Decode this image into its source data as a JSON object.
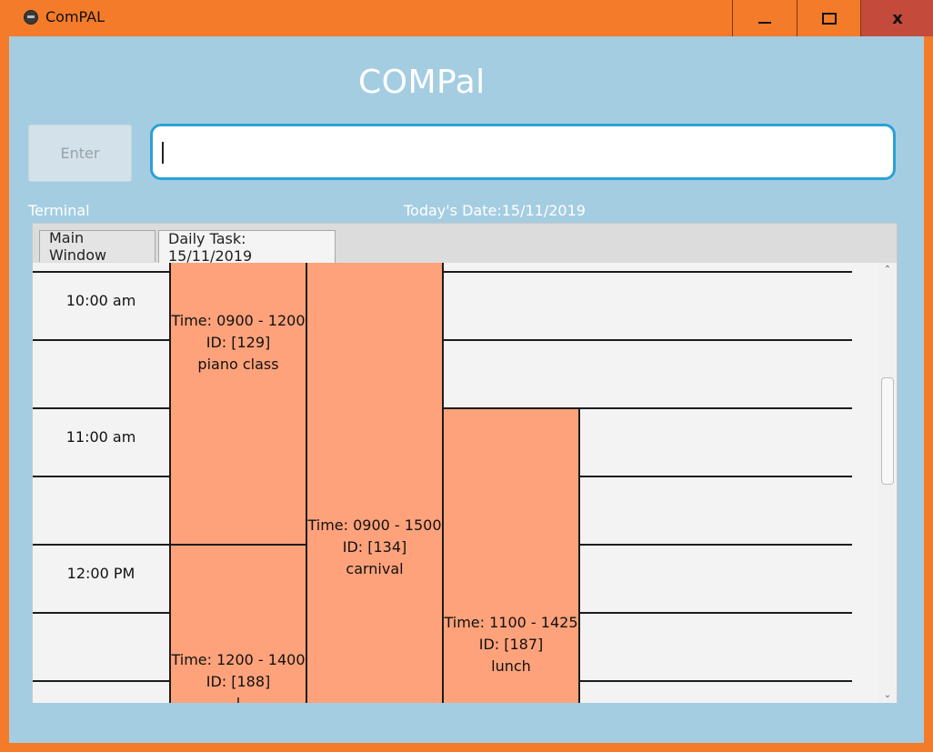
{
  "window": {
    "title": "ComPAL",
    "minimize_icon": "minimize-icon",
    "maximize_icon": "maximize-icon",
    "close_glyph": "x"
  },
  "app": {
    "heading": "COMPal",
    "enter_label": "Enter",
    "command_input_value": "",
    "terminal_label": "Terminal",
    "date_label": "Today's Date:15/11/2019"
  },
  "tabs": [
    {
      "label": "Main Window"
    },
    {
      "label": "Daily Task: 15/11/2019"
    }
  ],
  "schedule": {
    "time_labels": [
      "10:00 am",
      "11:00 am",
      "12:00 PM"
    ],
    "tasks": [
      {
        "time": "Time: 0900 - 1200",
        "id": "ID: [129]",
        "name": "piano class"
      },
      {
        "time": "Time: 0900 - 1500",
        "id": "ID: [134]",
        "name": "carnival"
      },
      {
        "time": "Time: 1100 - 1425",
        "id": "ID: [187]",
        "name": "lunch"
      },
      {
        "time": "Time: 1200 - 1400",
        "id": "ID: [188]",
        "name": "l"
      }
    ]
  },
  "colors": {
    "window_frame": "#f47b29",
    "background": "#a4cde2",
    "task_fill": "#fea27b",
    "input_border": "#2ba1d6"
  }
}
